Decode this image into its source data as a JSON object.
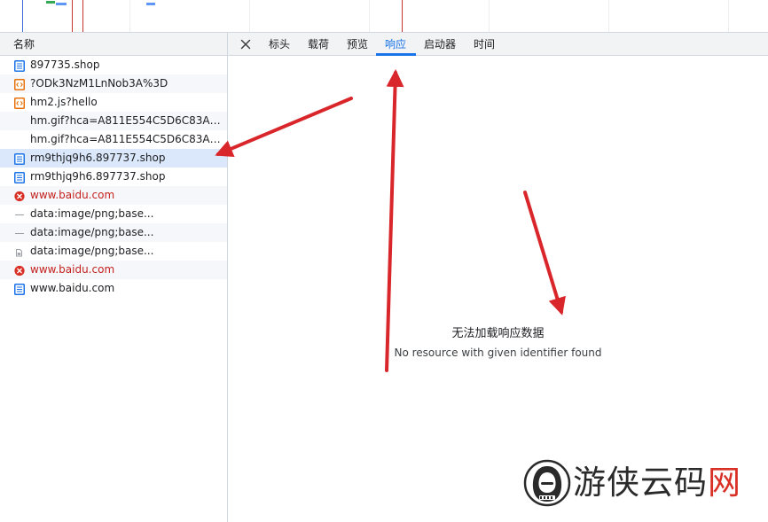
{
  "list": {
    "header": "名称",
    "rows": [
      {
        "label": "897735.shop",
        "icon": "document-icon",
        "color": "#1a73e8",
        "status": "normal"
      },
      {
        "label": "?ODk3NzM1LnNob3A%3D",
        "icon": "script-icon",
        "color": "#e8710a",
        "status": "normal"
      },
      {
        "label": "hm2.js?hello",
        "icon": "script-icon",
        "color": "#e8710a",
        "status": "normal"
      },
      {
        "label": "hm.gif?hca=A811E554C5D6C83A&c...",
        "icon": "",
        "color": "",
        "status": "normal"
      },
      {
        "label": "hm.gif?hca=A811E554C5D6C83A&c...",
        "icon": "",
        "color": "",
        "status": "normal"
      },
      {
        "label": "rm9thjq9h6.897737.shop",
        "icon": "document-icon",
        "color": "#1a73e8",
        "status": "selected"
      },
      {
        "label": "rm9thjq9h6.897737.shop",
        "icon": "document-icon",
        "color": "#1a73e8",
        "status": "normal"
      },
      {
        "label": "www.baidu.com",
        "icon": "error-icon",
        "color": "#d93025",
        "status": "error"
      },
      {
        "label": "data:image/png;base...",
        "icon": "image-dash-icon",
        "color": "#9aa0a6",
        "status": "normal"
      },
      {
        "label": "data:image/png;base...",
        "icon": "image-dash-icon",
        "color": "#9aa0a6",
        "status": "normal"
      },
      {
        "label": "data:image/png;base...",
        "icon": "image-file-icon",
        "color": "#9aa0a6",
        "status": "normal"
      },
      {
        "label": "www.baidu.com",
        "icon": "error-icon",
        "color": "#d93025",
        "status": "error"
      },
      {
        "label": "www.baidu.com",
        "icon": "document-icon",
        "color": "#1a73e8",
        "status": "normal"
      }
    ]
  },
  "detail": {
    "close_label": "close-icon",
    "tabs": [
      {
        "label": "标头",
        "active": false
      },
      {
        "label": "载荷",
        "active": false
      },
      {
        "label": "预览",
        "active": false
      },
      {
        "label": "响应",
        "active": true
      },
      {
        "label": "启动器",
        "active": false
      },
      {
        "label": "时间",
        "active": false
      }
    ],
    "message_title": "无法加载响应数据",
    "message_detail": "No resource with given identifier found"
  },
  "annotations": {
    "arrow_color": "#d9262b"
  },
  "watermark": {
    "text": "游侠云码网",
    "accent_color": "#d93025"
  },
  "colors": {
    "accent": "#1a73e8",
    "error": "#d93025",
    "selected_row": "#dbe8fb"
  }
}
